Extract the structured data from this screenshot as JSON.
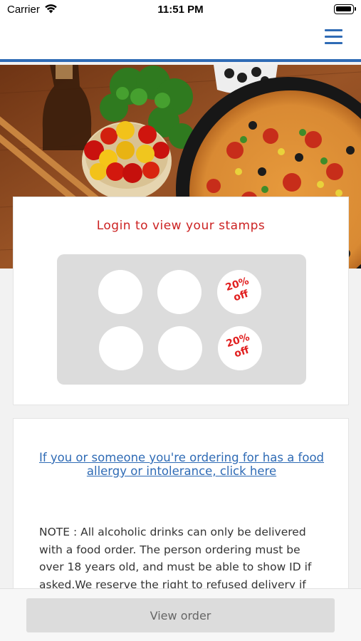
{
  "status_bar": {
    "carrier": "Carrier",
    "time": "11:51 PM"
  },
  "header": {
    "menu_icon": "hamburger-menu-icon",
    "accent_color": "#2f6bb5"
  },
  "stamps": {
    "title": "Login to view your stamps",
    "title_color": "#cc2222",
    "slots": [
      {
        "reward": ""
      },
      {
        "reward": ""
      },
      {
        "reward": "20%\noff"
      },
      {
        "reward": ""
      },
      {
        "reward": ""
      },
      {
        "reward": "20%\noff"
      }
    ]
  },
  "info": {
    "allergy_link": "If you or someone you're ordering for has a food allergy or intolerance, click here",
    "note": "NOTE : All alcoholic drinks can only be delivered with a food order. The person ordering must be over 18 years old, and must be able to show ID if asked.We reserve the right to refused delivery if"
  },
  "footer": {
    "view_order_label": "View order"
  }
}
